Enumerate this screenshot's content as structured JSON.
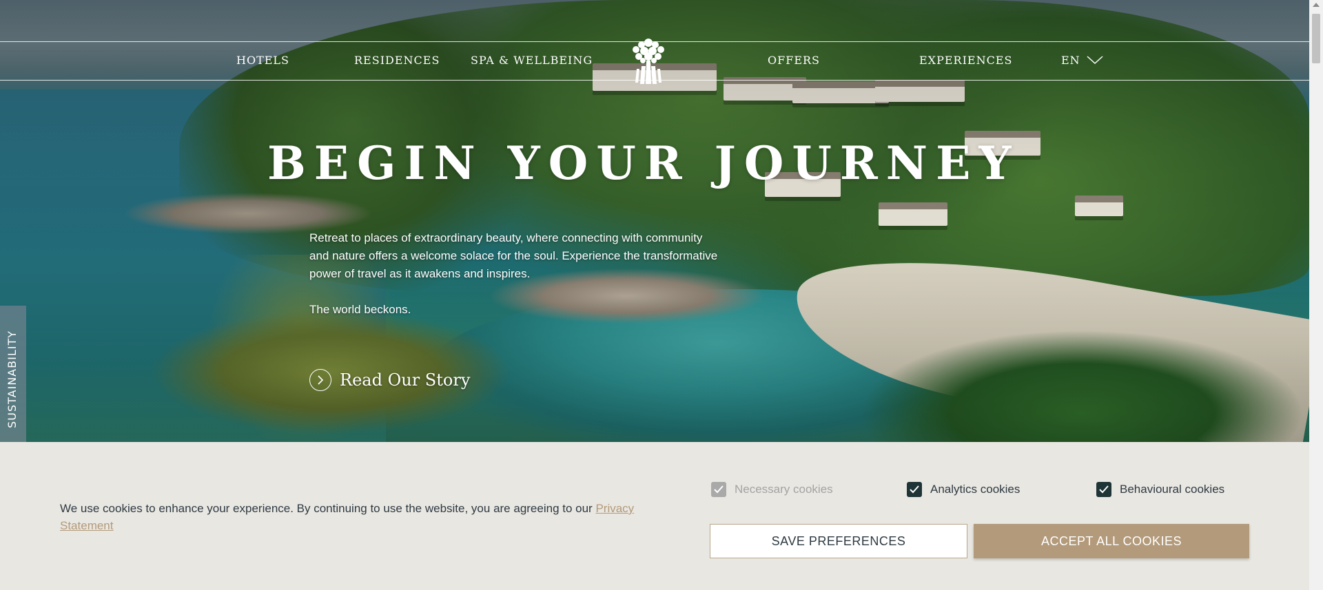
{
  "nav": {
    "items": [
      {
        "label": "HOTELS"
      },
      {
        "label": "RESIDENCES"
      },
      {
        "label": "SPA & WELLBEING"
      },
      {
        "label": "OFFERS"
      },
      {
        "label": "EXPERIENCES"
      }
    ],
    "language": "EN",
    "logo_icon": "tree-logo-icon"
  },
  "hero": {
    "title": "BEGIN YOUR JOURNEY",
    "body": [
      "Retreat to places of extraordinary beauty, where connecting with community and nature offers a welcome solace for the soul. Experience the transformative power of travel as it awakens and inspires.",
      "The world beckons."
    ],
    "cta_label": "Read Our Story",
    "cta_icon": "chevron-right-circle-icon"
  },
  "side_tab": {
    "label": "SUSTAINABILITY"
  },
  "cookie_banner": {
    "message": "We use cookies to enhance your experience. By continuing to use the website, you are agreeing to our ",
    "link_text": "Privacy Statement",
    "options": [
      {
        "label": "Necessary cookies",
        "checked": true,
        "disabled": true
      },
      {
        "label": "Analytics cookies",
        "checked": true,
        "disabled": false
      },
      {
        "label": "Behavioural cookies",
        "checked": true,
        "disabled": false
      }
    ],
    "save_label": "SAVE PREFERENCES",
    "accept_label": "ACCEPT ALL COOKIES",
    "colors": {
      "accent": "#b39a7a",
      "checkbox": "#1f3437",
      "text": "#2e3a42"
    }
  }
}
